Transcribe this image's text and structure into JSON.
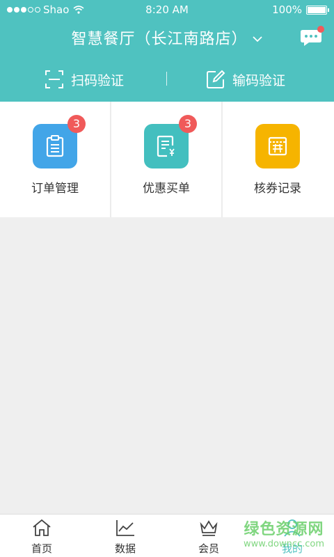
{
  "status_bar": {
    "carrier": "Shao",
    "time": "8:20 AM",
    "battery": "100%",
    "battery_level": 1.0
  },
  "header": {
    "store_name": "智慧餐厅（长江南路店）",
    "has_unread_messages": true,
    "actions": [
      {
        "label": "扫码验证",
        "icon": "scan-icon"
      },
      {
        "label": "输码验证",
        "icon": "edit-icon"
      }
    ]
  },
  "grid": [
    {
      "label": "订单管理",
      "badge": "3",
      "icon": "clipboard-icon",
      "color": "#42a5e8"
    },
    {
      "label": "优惠买单",
      "badge": "3",
      "icon": "receipt-yen-icon",
      "color": "#43bfbf"
    },
    {
      "label": "核券记录",
      "badge": "",
      "icon": "coupon-icon",
      "color": "#f6b400"
    }
  ],
  "tabs": [
    {
      "label": "首页",
      "icon": "home-icon"
    },
    {
      "label": "数据",
      "icon": "chart-icon"
    },
    {
      "label": "会员",
      "icon": "crown-icon"
    },
    {
      "label": "我的",
      "icon": "user-icon"
    }
  ],
  "colors": {
    "primary": "#4fc2c0",
    "badge": "#f05a5a"
  },
  "watermark": {
    "line1": "绿色资源网",
    "line2": "www.downcc.com"
  }
}
